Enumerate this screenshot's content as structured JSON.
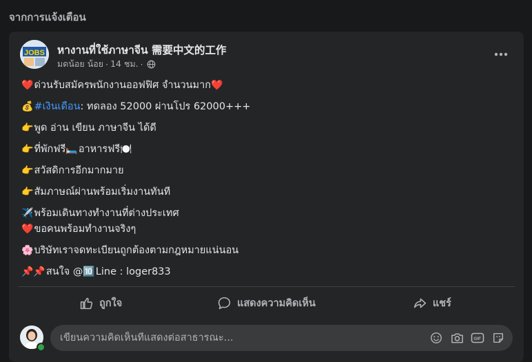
{
  "section": {
    "title": "จากการแจ้งเตือน"
  },
  "post": {
    "author": "หางานที่ใช้ภาษาจีน 需要中文的工作",
    "author_sub": "มดน้อย น้อย",
    "time": "14 ชม.",
    "separator": "·",
    "lines": [
      {
        "emoji_before": "❤️",
        "text": "ด่วนรับสมัครพนักงานออฟฟิศ จำนวนมาก",
        "emoji_after": "❤️"
      },
      {
        "emoji_before": "💰",
        "hashtag": "#เงินเดือน",
        "text": " : ทดลอง 52000  ผ่านโปร 62000+++"
      },
      {
        "emoji_before": "👉",
        "text": "พูด อ่าน เขียน ภาษาจีน ได้ดี"
      },
      {
        "emoji_before": "👉",
        "text": "ที่พักฟรี ",
        "emoji_mid": "🛏️",
        "text2": "อาหารฟรี",
        "emoji_after": "🍽️"
      },
      {
        "emoji_before": "👉",
        "text": "สวัสดิการอีกมากมาย"
      },
      {
        "emoji_before": "👉",
        "text": "สัมภาษณ์ผ่านพร้อมเริ่มงานทันที"
      },
      {
        "emoji_before": "✈️",
        "text": "พร้อมเดินทางทำงานที่ต่างประเทศ"
      },
      {
        "emoji_before": "❤️",
        "text": "ขอคนพร้อมทำงานจริงๆ"
      },
      {
        "emoji_before": "🌸",
        "text": "บริษัทเราจดทะเบียนถูกต้องตามกฎหมายแน่นอน"
      },
      {
        "emoji_before": "📌📌",
        "text": "สนใจ @ ",
        "emoji_mid": "🔟",
        "text2": "Line : loger833"
      }
    ]
  },
  "actions": {
    "like": "ถูกใจ",
    "comment": "แสดงความคิดเห็น",
    "share": "แชร์"
  },
  "comment_box": {
    "placeholder": "เขียนความคิดเห็นที่แสดงต่อสาธารณะ..."
  },
  "icons": {
    "more": "more-options-icon",
    "globe": "globe-icon",
    "like": "thumbs-up-icon",
    "comment": "comment-bubble-icon",
    "share": "share-arrow-icon",
    "emoji": "emoji-icon",
    "camera": "camera-icon",
    "gif": "gif-icon",
    "sticker": "sticker-icon"
  },
  "colors": {
    "background": "#18191a",
    "card": "#242526",
    "link": "#4599ff",
    "text": "#e4e6eb",
    "secondary": "#b0b3b8"
  }
}
